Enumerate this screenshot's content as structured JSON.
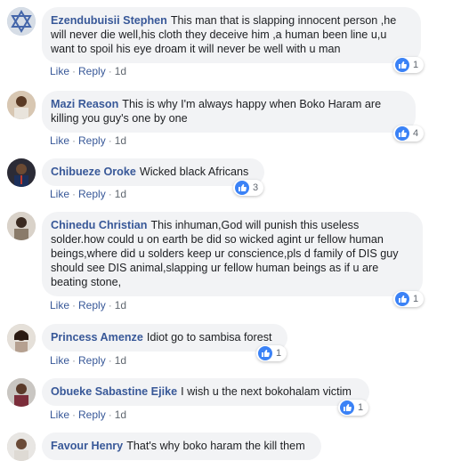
{
  "actions": {
    "like": "Like",
    "reply": "Reply",
    "sep": "·"
  },
  "comments": [
    {
      "name": "Ezendubuisii Stephen",
      "text": "This man that is slapping innocent person ,he will never die well,his cloth they deceive him ,a human been line u,u want to spoil his eye droam it will never be well with u man",
      "time": "1d",
      "reactions": "1"
    },
    {
      "name": "Mazi Reason",
      "text": "This is why I'm always happy when Boko Haram are killing you guy's one by one",
      "time": "1d",
      "reactions": "4"
    },
    {
      "name": "Chibueze Oroke",
      "text": "Wicked black Africans",
      "time": "1d",
      "reactions": "3"
    },
    {
      "name": "Chinedu Christian",
      "text": "This inhuman,God will punish this useless solder.how could u on earth be did so wicked agint ur fellow human beings,where did u solders keep ur conscience,pls d family of DIS guy should see DIS animal,slapping ur fellow human beings as if u are beating stone,",
      "time": "1d",
      "reactions": "1"
    },
    {
      "name": "Princess Amenze",
      "text": "Idiot go to sambisa forest",
      "time": "1d",
      "reactions": "1"
    },
    {
      "name": "Obueke Sabastine Ejike",
      "text": "I wish u the next bokohalam victim",
      "time": "1d",
      "reactions": "1"
    },
    {
      "name": "Favour Henry",
      "text": "That's why boko haram the kill them",
      "time": "",
      "reactions": ""
    }
  ],
  "colors": {
    "link": "#385898",
    "bubble": "#f2f3f5",
    "like": "#3b82f6"
  },
  "icons": {
    "reaction": "thumbs-up-icon"
  }
}
